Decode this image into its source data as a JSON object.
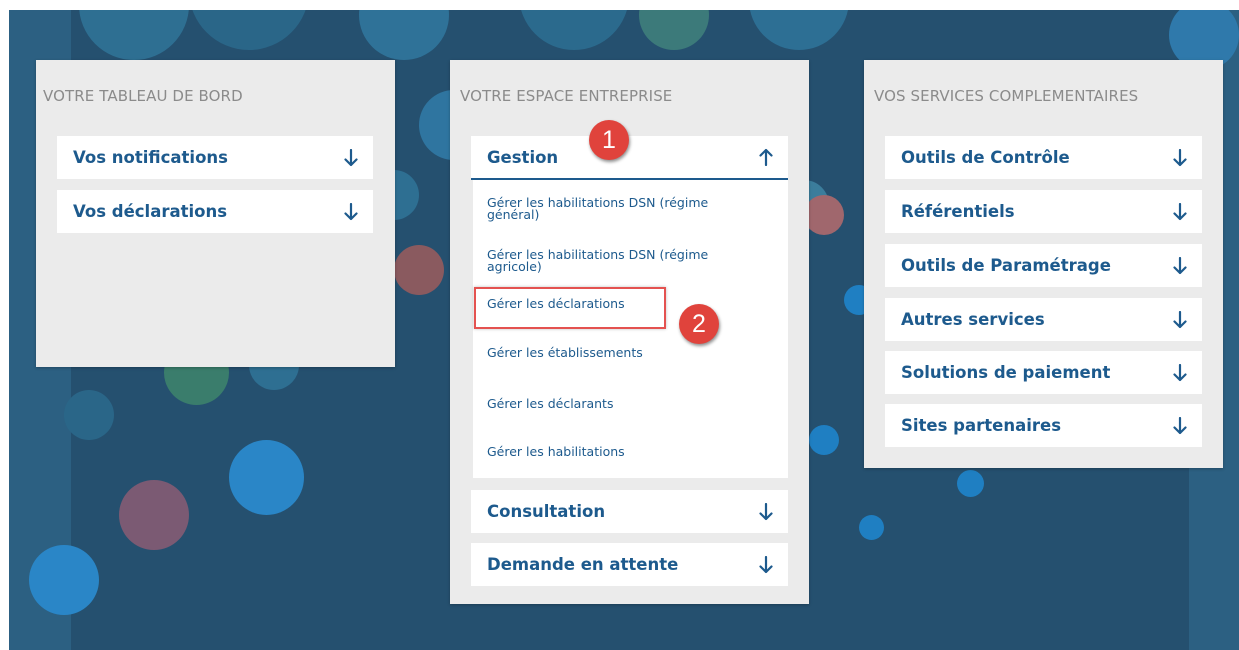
{
  "dashboard": {
    "title": "VOTRE TABLEAU DE BORD",
    "items": [
      {
        "label": "Vos notifications",
        "icon": "arrow-down-icon"
      },
      {
        "label": "Vos déclarations",
        "icon": "arrow-down-icon"
      }
    ]
  },
  "enterprise": {
    "title": "VOTRE ESPACE ENTREPRISE",
    "gestion": {
      "label": "Gestion",
      "icon": "arrow-up-icon",
      "expanded": true
    },
    "sublinks": [
      "Gérer les habilitations DSN (régime général)",
      "Gérer les habilitations DSN (régime agricole)",
      "Gérer les déclarations",
      "Gérer les établissements",
      "Gérer les déclarants",
      "Gérer les habilitations"
    ],
    "consultation": {
      "label": "Consultation",
      "icon": "arrow-down-icon"
    },
    "pending": {
      "label": "Demande en attente",
      "icon": "arrow-down-icon"
    }
  },
  "services": {
    "title": "VOS SERVICES COMPLEMENTAIRES",
    "items": [
      {
        "label": "Outils de Contrôle",
        "icon": "arrow-down-icon"
      },
      {
        "label": "Référentiels",
        "icon": "arrow-down-icon"
      },
      {
        "label": "Outils de Paramétrage",
        "icon": "arrow-down-icon"
      },
      {
        "label": "Autres services",
        "icon": "arrow-down-icon"
      },
      {
        "label": "Solutions de paiement",
        "icon": "arrow-down-icon"
      },
      {
        "label": "Sites partenaires",
        "icon": "arrow-down-icon"
      }
    ]
  },
  "annotations": {
    "step1": "1",
    "step2": "2"
  },
  "colors": {
    "background": "#25506f",
    "panel": "#ebebeb",
    "link": "#1d5a8d",
    "badge": "#e0433c"
  }
}
